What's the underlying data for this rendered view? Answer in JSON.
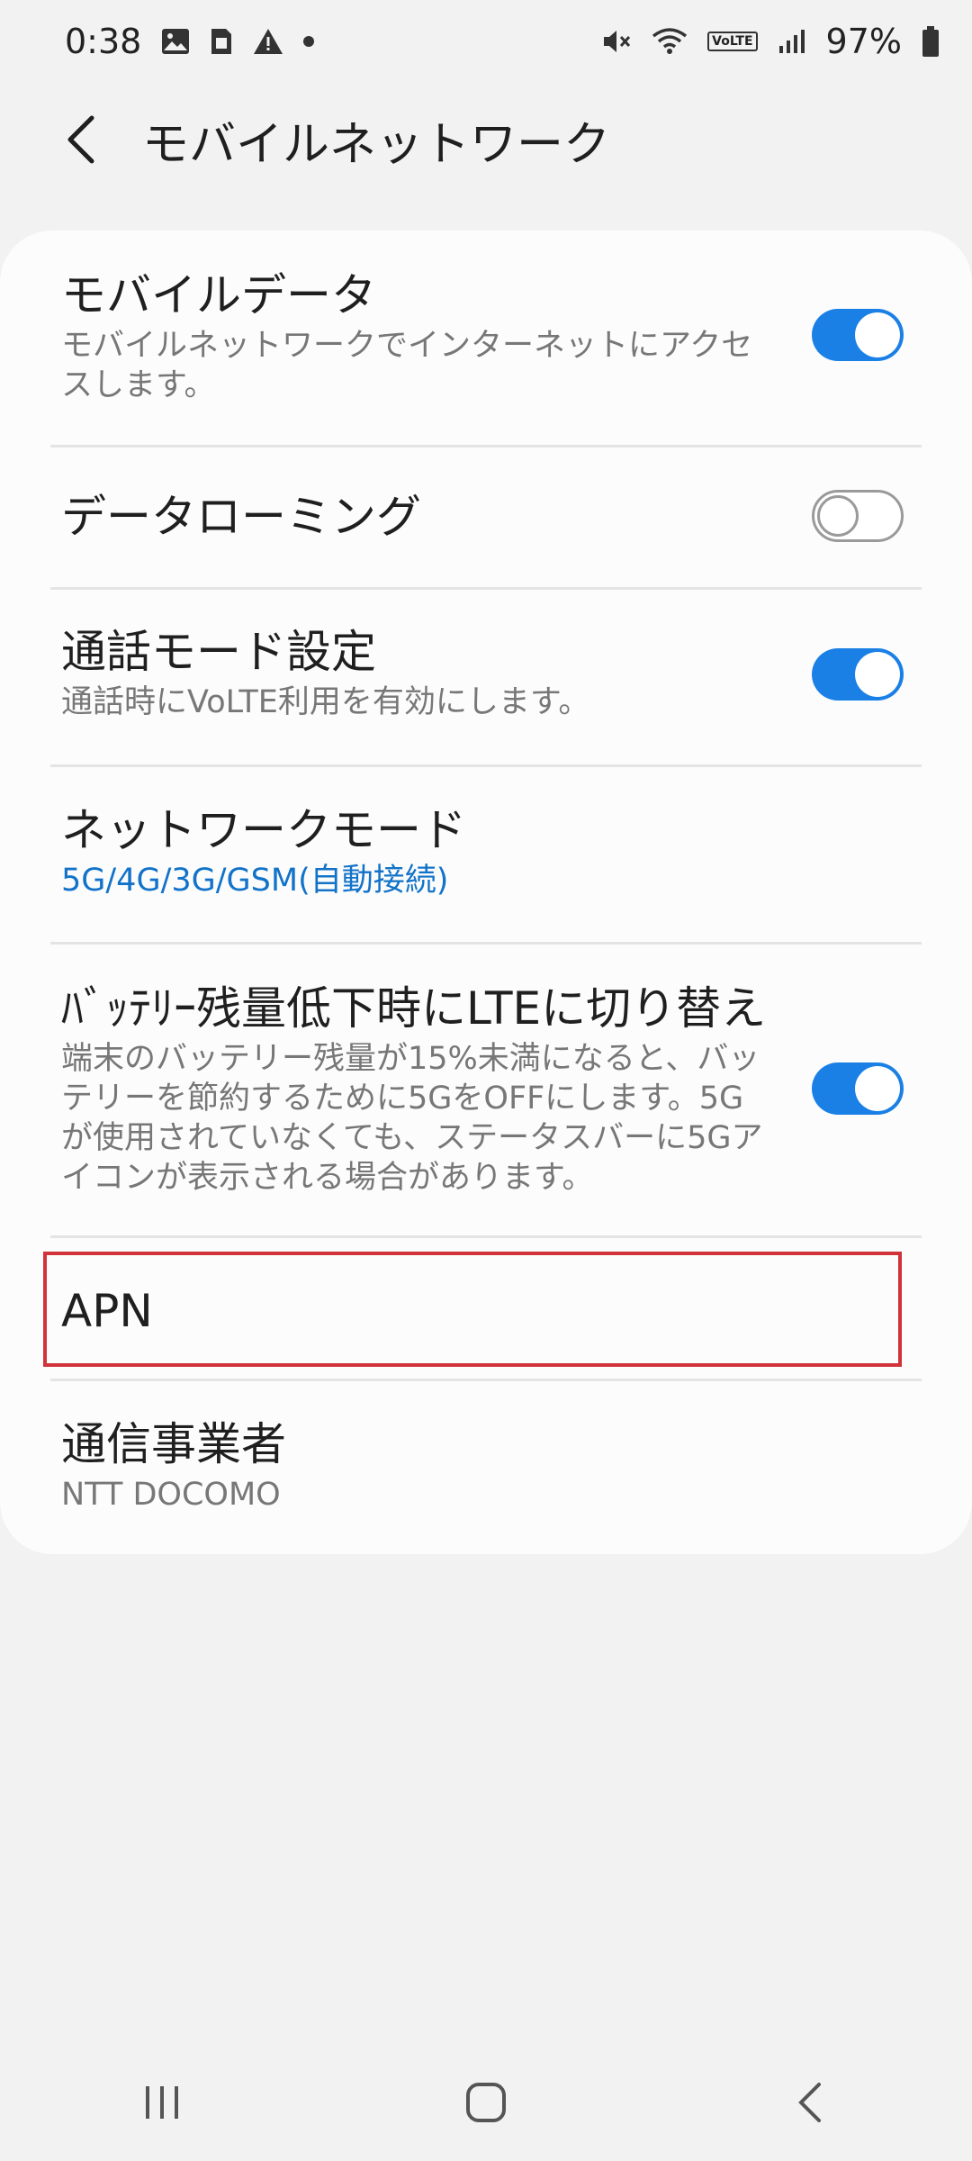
{
  "status_bar": {
    "time": "0:38",
    "left_icons": [
      "image-icon",
      "sim-icon",
      "warning-icon",
      "dot-icon"
    ],
    "right_icons": [
      "mute-icon",
      "wifi-icon",
      "volte-icon",
      "signal-icon",
      "battery-icon"
    ],
    "volte_label": "VoLTE",
    "battery": "97%"
  },
  "header": {
    "title": "モバイルネットワーク"
  },
  "settings": [
    {
      "id": "mobile-data",
      "title": "モバイルデータ",
      "subtitle": "モバイルネットワークでインターネットにアクセスします。",
      "toggle": true
    },
    {
      "id": "data-roaming",
      "title": "データローミング",
      "subtitle": "",
      "toggle": false
    },
    {
      "id": "call-mode",
      "title": "通話モード設定",
      "subtitle": "通話時にVoLTE利用を有効にします。",
      "toggle": true
    },
    {
      "id": "network-mode",
      "title": "ネットワークモード",
      "subtitle": "5G/4G/3G/GSM(自動接続)"
    },
    {
      "id": "battery-lte",
      "title": "ﾊﾞｯﾃﾘｰ残量低下時にLTEに切り替え",
      "subtitle": "端末のバッテリー残量が15%未満になると、バッテリーを節約するために5GをOFFにします。5Gが使用されていなくても、ステータスバーに5Gアイコンが表示される場合があります。",
      "toggle": true
    },
    {
      "id": "apn",
      "title": "APN"
    },
    {
      "id": "carrier",
      "title": "通信事業者",
      "subtitle": "NTT DOCOMO"
    }
  ],
  "colors": {
    "accent": "#1a80e6",
    "highlight": "#d0343a",
    "link_blue": "#1273c9"
  }
}
